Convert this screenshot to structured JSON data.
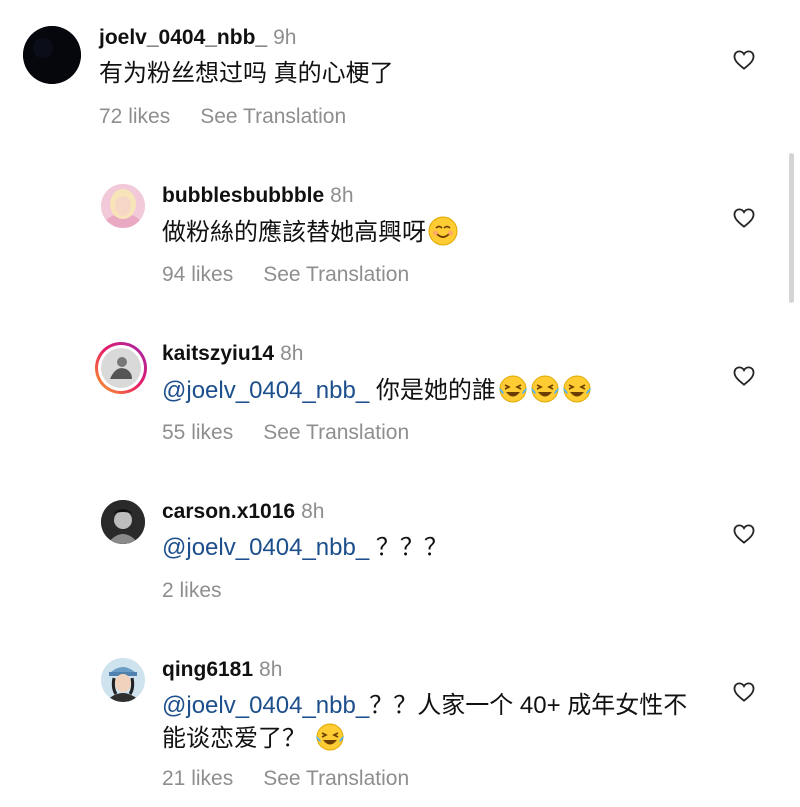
{
  "comments": [
    {
      "username": "joelv_0404_nbb_",
      "time": "9h",
      "mention": "",
      "text": "有为粉丝想过吗 真的心梗了",
      "likes": "72 likes",
      "translate": "See Translation",
      "emojis": []
    },
    {
      "username": "bubblesbubbble",
      "time": "8h",
      "mention": "",
      "text": "做粉絲的應該替她高興呀",
      "likes": "94 likes",
      "translate": "See Translation",
      "emojis": [
        "smiling-face"
      ]
    },
    {
      "username": "kaitszyiu14",
      "time": "8h",
      "mention": "@joelv_0404_nbb_",
      "text": " 你是她的誰",
      "likes": "55 likes",
      "translate": "See Translation",
      "emojis": [
        "tears-of-joy",
        "tears-of-joy",
        "tears-of-joy"
      ]
    },
    {
      "username": "carson.x1016",
      "time": "8h",
      "mention": "@joelv_0404_nbb_",
      "text": " ？？？",
      "likes": "2 likes",
      "translate": "",
      "emojis": []
    },
    {
      "username": "qing6181",
      "time": "8h",
      "mention": "@joelv_0404_nbb_",
      "text": "？？人家一个 40+ 成年女性不能谈恋爱了？",
      "likes": "21 likes",
      "translate": "See Translation",
      "emojis": [
        "tears-of-joy"
      ]
    }
  ],
  "icons": {
    "like": "heart-outline-icon"
  },
  "colors": {
    "mention": "#1c4f8c",
    "secondary": "#8e8e8e",
    "text": "#111111"
  }
}
